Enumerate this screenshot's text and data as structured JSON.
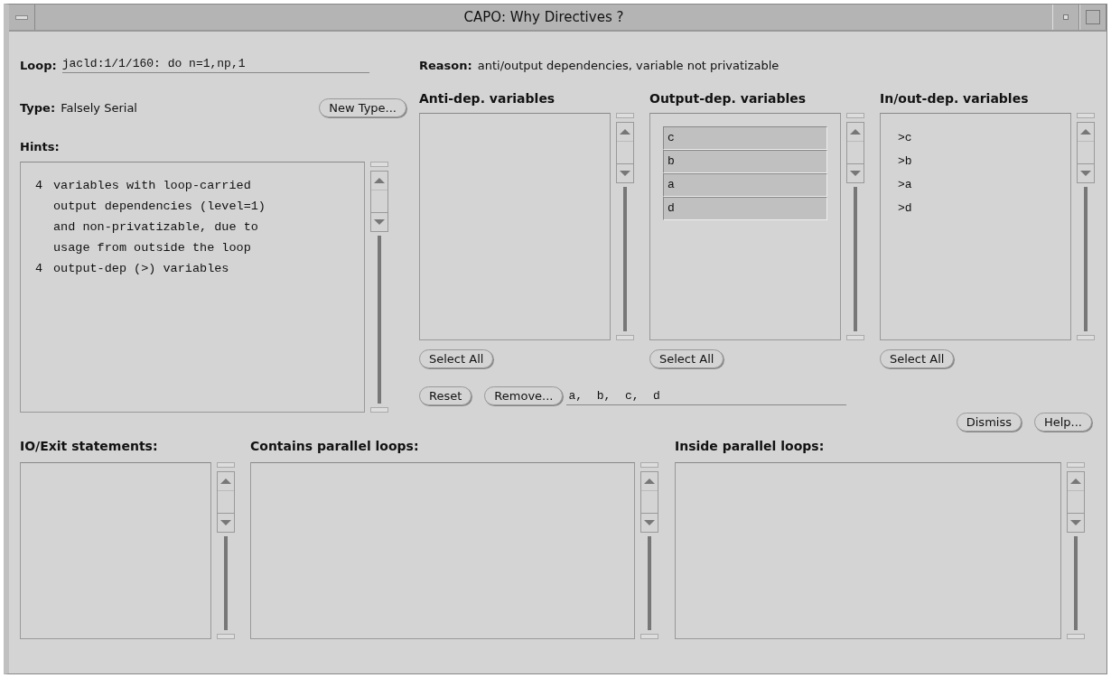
{
  "window": {
    "title": "CAPO: Why Directives ?"
  },
  "loop": {
    "label": "Loop:",
    "value": "jacld:1/1/160:  do n=1,np,1"
  },
  "reason": {
    "label": "Reason:",
    "value": "anti/output dependencies, variable not privatizable"
  },
  "type": {
    "label": "Type:",
    "value": "Falsely Serial",
    "button": "New Type..."
  },
  "hints": {
    "label": "Hints:",
    "entries": [
      {
        "count": "4",
        "lines": [
          "variables with loop-carried",
          "output dependencies (level=1)",
          "and non-privatizable, due to",
          "usage from outside the loop"
        ]
      },
      {
        "count": "4",
        "lines": [
          "output-dep (>) variables"
        ]
      }
    ]
  },
  "variable_lists": [
    {
      "title": "Anti-dep. variables",
      "button": "Select All"
    },
    {
      "title": "Output-dep. variables",
      "button": "Select All",
      "items": [
        {
          "label": "c",
          "selected": true
        },
        {
          "label": "b",
          "selected": true
        },
        {
          "label": "a",
          "selected": true
        },
        {
          "label": "d",
          "selected": true
        }
      ]
    },
    {
      "title": "In/out-dep. variables",
      "button": "Select All",
      "items": [
        {
          "label": ">c",
          "selected": false
        },
        {
          "label": ">b",
          "selected": false
        },
        {
          "label": ">a",
          "selected": false
        },
        {
          "label": ">d",
          "selected": false
        }
      ]
    }
  ],
  "actions": {
    "reset": "Reset",
    "remove": "Remove...",
    "selection": "a,  b,  c,  d"
  },
  "dialog_buttons": [
    "Dismiss",
    "Help..."
  ],
  "bottom_lists": [
    {
      "title": "IO/Exit statements:"
    },
    {
      "title": "Contains parallel loops:"
    },
    {
      "title": "Inside parallel loops:"
    }
  ]
}
